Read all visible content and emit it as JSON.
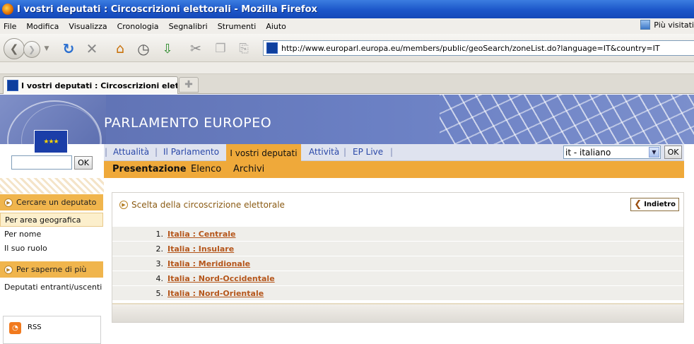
{
  "window": {
    "title": "I vostri deputati : Circoscrizioni elettorali - Mozilla Firefox"
  },
  "menubar": {
    "items": [
      "File",
      "Modifica",
      "Visualizza",
      "Cronologia",
      "Segnalibri",
      "Strumenti",
      "Aiuto"
    ],
    "most_visited": "Più visitati"
  },
  "toolbar": {
    "url": "http://www.europarl.europa.eu/members/public/geoSearch/zoneList.do?language=IT&country=IT",
    "icons": [
      "back-icon",
      "forward-icon",
      "history-dropdown-icon",
      "reload-icon",
      "stop-icon",
      "home-icon",
      "history-clock-icon",
      "download-icon",
      "cut-icon",
      "copy-icon",
      "paste-icon"
    ]
  },
  "tabs": [
    {
      "label": "I vostri deputati : Circoscrizioni elett...",
      "active": true
    }
  ],
  "site": {
    "title": "PARLAMENTO EUROPEO",
    "nav": [
      "Attualità",
      "Il Parlamento",
      "I vostri deputati",
      "Attività",
      "EP Live"
    ],
    "nav_active": "I vostri deputati",
    "language_value": "it - italiano",
    "ok_label": "OK",
    "search_value": "",
    "subnav": [
      "Presentazione",
      "Elenco",
      "Archivi"
    ],
    "subnav_active": "Presentazione"
  },
  "sidebar": {
    "section1_title": "Cercare un deputato",
    "section1_items": [
      "Per area geografica",
      "Per nome",
      "Il suo ruolo"
    ],
    "section1_selected": "Per area geografica",
    "section2_title": "Per saperne di più",
    "section2_items": [
      "Deputati entranti/uscenti"
    ],
    "rss_label": "RSS"
  },
  "main": {
    "heading": "Scelta della circoscrizione elettorale",
    "back_label": "Indietro",
    "zones": [
      {
        "num": "1.",
        "label": "Italia : Centrale"
      },
      {
        "num": "2.",
        "label": "Italia : Insulare"
      },
      {
        "num": "3.",
        "label": "Italia : Meridionale"
      },
      {
        "num": "4.",
        "label": "Italia : Nord-Occidentale"
      },
      {
        "num": "5.",
        "label": "Italia : Nord-Orientale"
      }
    ]
  },
  "colors": {
    "accent": "#efa93a",
    "banner": "#6b80c4",
    "link": "#b5561b",
    "nav_link": "#2a48a8"
  }
}
